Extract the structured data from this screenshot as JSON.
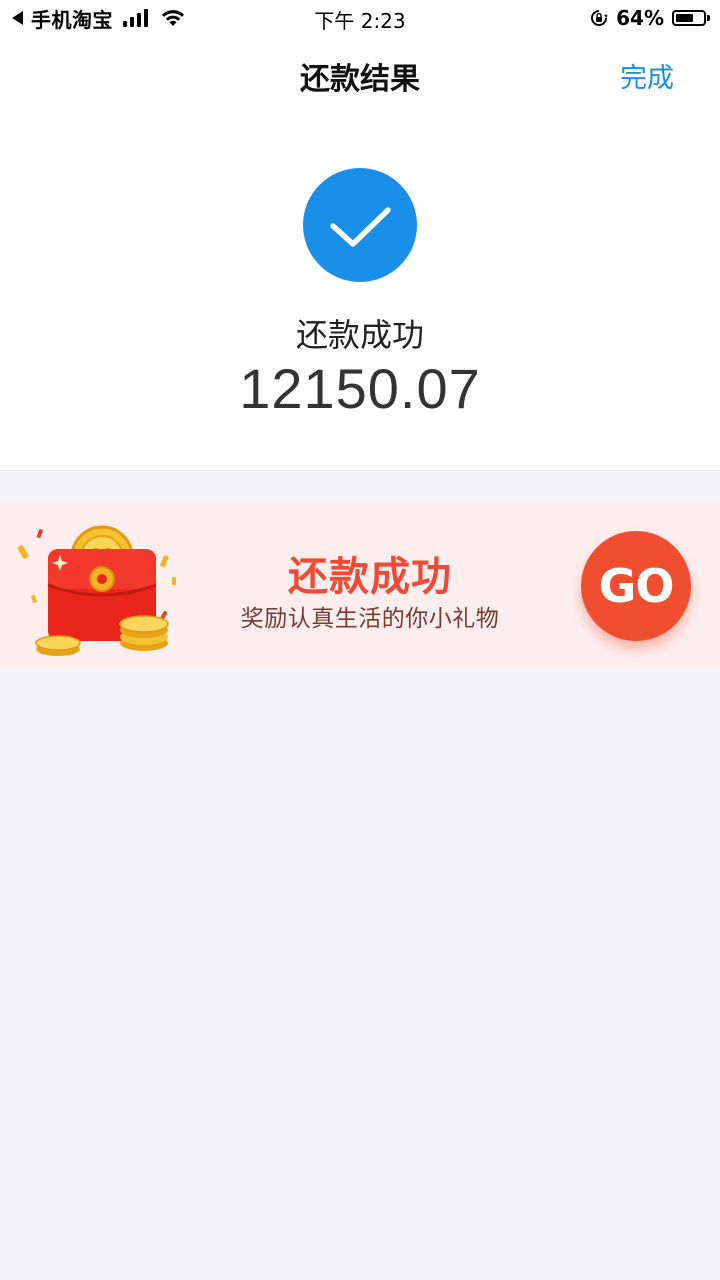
{
  "status_bar": {
    "back_app_label": "手机淘宝",
    "time": "下午 2:23",
    "battery_percent": "64%",
    "battery_level": 0.64,
    "signal_bars": 4,
    "icons": [
      "back-caret-icon",
      "signal-icon",
      "wifi-icon",
      "orientation-lock-icon",
      "battery-icon"
    ]
  },
  "nav": {
    "title": "还款结果",
    "done_label": "完成"
  },
  "result": {
    "icon": "checkmark-icon",
    "status_text": "还款成功",
    "amount": "12150.07"
  },
  "promo": {
    "title": "还款成功",
    "subtitle": "奖励认真生活的你小礼物",
    "button_label": "GO",
    "illustration": "red-gift-box-with-coins"
  },
  "colors": {
    "accent_blue": "#1a8fe8",
    "promo_red": "#ee4a35",
    "go_button": "#f04e31",
    "banner_background": "#fdeeee",
    "page_background": "#f2f2f7"
  }
}
